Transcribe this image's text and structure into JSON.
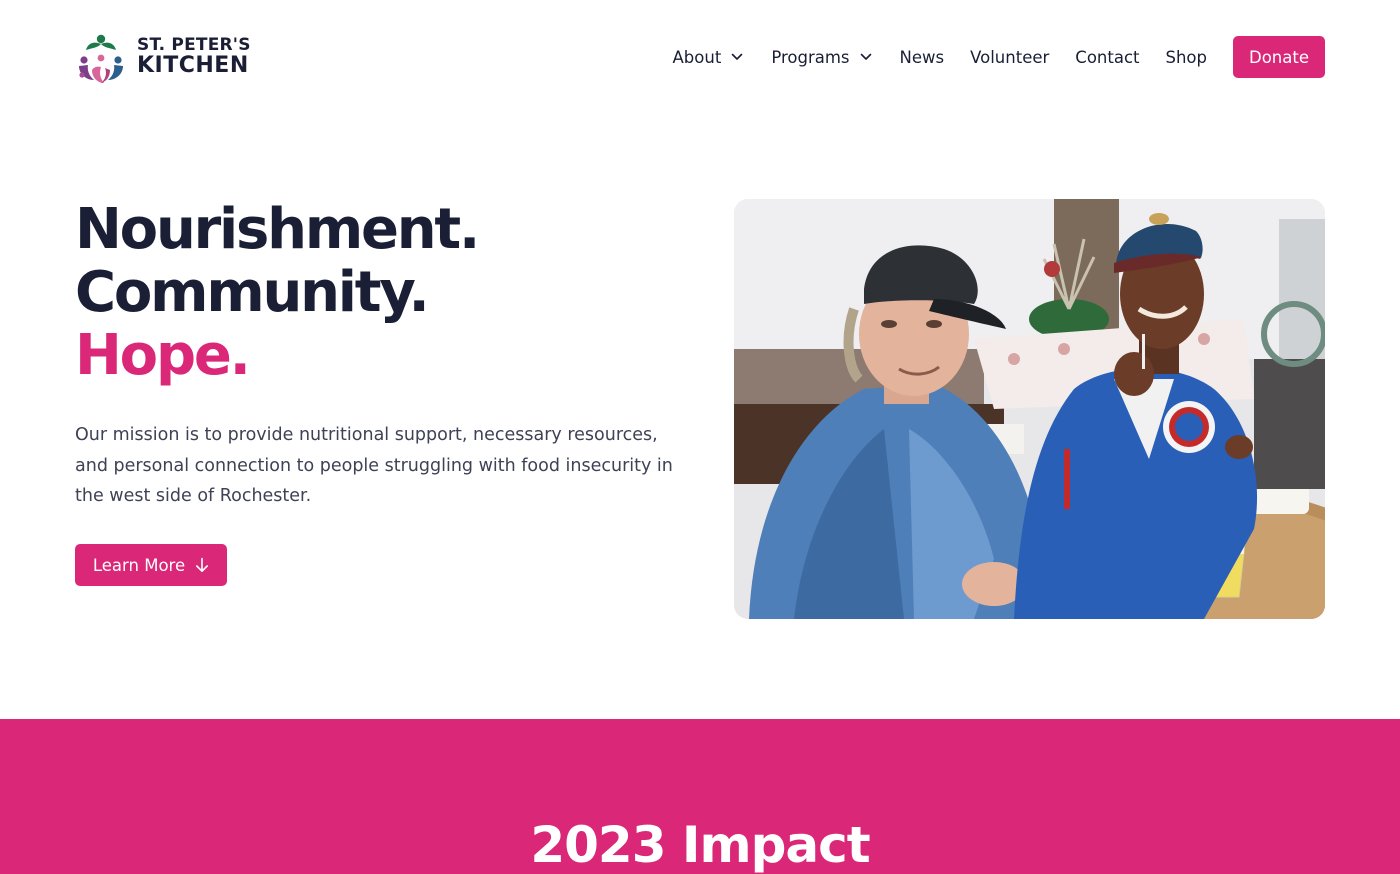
{
  "brand": {
    "name_line1": "ST. PETER'S",
    "name_line2": "KITCHEN",
    "colors": {
      "accent": "#db2777",
      "dark": "#1a1f36",
      "logo_green": "#1f7a4a",
      "logo_purple": "#7b3f8c",
      "logo_pink": "#d9669a",
      "logo_blue": "#2b5f8c"
    }
  },
  "nav": {
    "items": [
      {
        "label": "About",
        "dropdown": true
      },
      {
        "label": "Programs",
        "dropdown": true
      },
      {
        "label": "News",
        "dropdown": false
      },
      {
        "label": "Volunteer",
        "dropdown": false
      },
      {
        "label": "Contact",
        "dropdown": false
      },
      {
        "label": "Shop",
        "dropdown": false
      }
    ],
    "donate_label": "Donate"
  },
  "hero": {
    "title_line1": "Nourishment.",
    "title_line2": "Community.",
    "title_line3": "Hope.",
    "mission": "Our mission is to provide nutritional support, necessary resources, and personal connection to people struggling with food insecurity in the west side of Rochester.",
    "cta_label": "Learn More",
    "cta_icon": "arrow-down-icon"
  },
  "impact": {
    "title": "2023 Impact"
  }
}
